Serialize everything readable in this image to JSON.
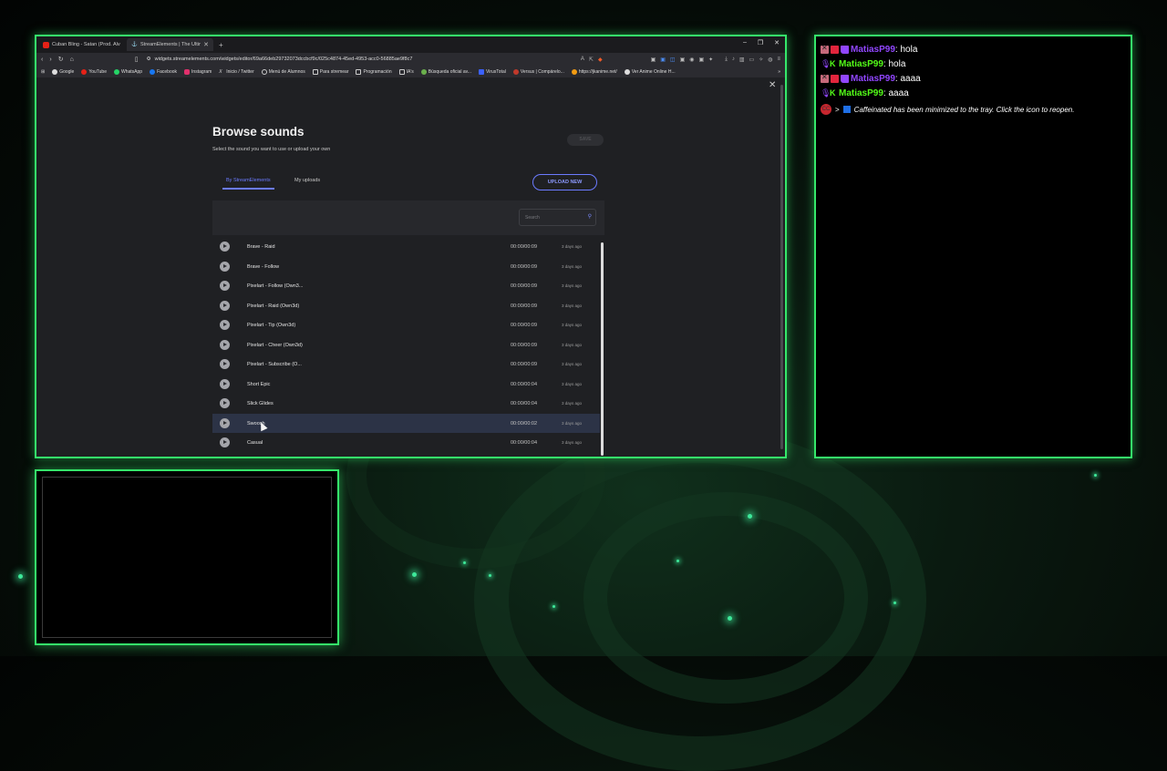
{
  "browser": {
    "tabs": [
      {
        "title": "Cuban Bling - Satan (Prod. Alvo Lov...",
        "active": false
      },
      {
        "title": "StreamElements | The Ultimate S...",
        "active": true
      }
    ],
    "url": "widgets.streamelements.com/widgets/editor/69a66deb29732073dccbcf9c/025c4874-45ed-4953-acc0-56885ae9f8c7",
    "bookmarks": [
      "Google",
      "YouTube",
      "WhatsApp",
      "Facebook",
      "Instagram",
      "Inicio / Twitter",
      "Menú de Alumnos",
      "Para stremear",
      "Programación",
      "IA's",
      "Búsqueda oficial av...",
      "VirusTotal",
      "Versus | Compárelo...",
      "https://jkanime.net/",
      "Ver Anime Online H..."
    ]
  },
  "modal": {
    "title": "Browse sounds",
    "subtitle": "Select the sound you want to use or upload your own",
    "save_label": "SAVE",
    "tab_by": "By StreamElements",
    "tab_my": "My uploads",
    "upload_label": "UPLOAD NEW",
    "search_placeholder": "Search",
    "sounds": [
      {
        "name": "Brave - Raid",
        "duration": "00:00/00:09",
        "age": "3 days ago"
      },
      {
        "name": "Brave - Follow",
        "duration": "00:00/00:09",
        "age": "3 days ago"
      },
      {
        "name": "Pixelart - Follow (Own3...",
        "duration": "00:00/00:09",
        "age": "3 days ago"
      },
      {
        "name": "Pixelart - Raid (Own3d)",
        "duration": "00:00/00:09",
        "age": "3 days ago"
      },
      {
        "name": "Pixelart - Tip (Own3d)",
        "duration": "00:00/00:09",
        "age": "3 days ago"
      },
      {
        "name": "Pixelart - Cheer (Own3d)",
        "duration": "00:00/00:09",
        "age": "3 days ago"
      },
      {
        "name": "Pixelart - Subscribe (O...",
        "duration": "00:00/00:09",
        "age": "3 days ago"
      },
      {
        "name": "Short Epic",
        "duration": "00:00/00:04",
        "age": "3 days ago"
      },
      {
        "name": "Slick Glides",
        "duration": "00:00/00:04",
        "age": "3 days ago"
      },
      {
        "name": "Swoosh",
        "duration": "00:00/00:02",
        "age": "3 days ago",
        "selected": true
      },
      {
        "name": "Casual",
        "duration": "00:00/00:04",
        "age": "3 days ago"
      }
    ]
  },
  "chat": {
    "messages": [
      {
        "platform": "twitch",
        "user": "MatiasP99",
        "text": ": hola"
      },
      {
        "platform": "kick",
        "user": "MatiasP99",
        "text": ": hola"
      },
      {
        "platform": "twitch",
        "user": "MatiasP99",
        "text": ": aaaa"
      },
      {
        "platform": "kick",
        "user": "MatiasP99",
        "text": ": aaaa"
      }
    ],
    "system_prefix": ">",
    "system_message": "Caffeinated has been minimized to the tray. Click the icon to reopen.",
    "system_badge": "CC"
  },
  "colors": {
    "frame": "#35e86a",
    "accent": "#6b7bff",
    "twitch": "#9146ff",
    "kick": "#53fc18"
  }
}
